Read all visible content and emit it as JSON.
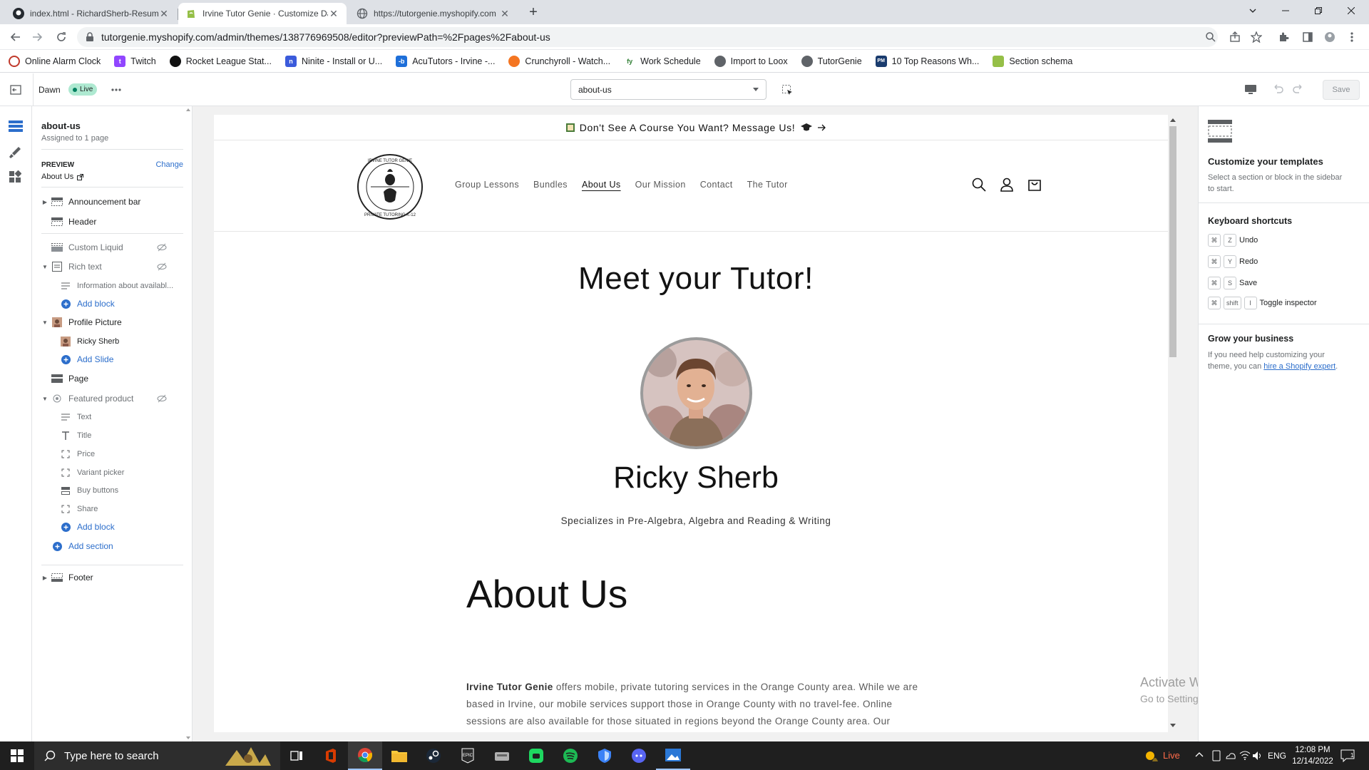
{
  "browser": {
    "tabs": [
      {
        "title": "index.html - RichardSherb-Resum",
        "active": false
      },
      {
        "title": "Irvine Tutor Genie · Customize Da",
        "active": true
      },
      {
        "title": "https://tutorgenie.myshopify.com",
        "active": false
      }
    ],
    "url": "tutorgenie.myshopify.com/admin/themes/138776969508/editor?previewPath=%2Fpages%2Fabout-us",
    "bookmarks": [
      "Online Alarm Clock",
      "Twitch",
      "Rocket League Stat...",
      "Ninite - Install or U...",
      "AcuTutors - Irvine -...",
      "Crunchyroll - Watch...",
      "Work Schedule",
      "Import to Loox",
      "TutorGenie",
      "10 Top Reasons Wh...",
      "Section schema"
    ]
  },
  "editor": {
    "theme_name": "Dawn",
    "live_badge": "Live",
    "template_select": "about-us",
    "save_label": "Save"
  },
  "sidebar": {
    "template_title": "about-us",
    "assigned": "Assigned to 1 page",
    "preview_label": "PREVIEW",
    "change_label": "Change",
    "preview_page": "About Us",
    "items": [
      {
        "label": "Announcement bar"
      },
      {
        "label": "Header"
      },
      {
        "label": "Custom Liquid"
      },
      {
        "label": "Rich text"
      },
      {
        "label": "Information about availabl..."
      },
      {
        "label": "Add block"
      },
      {
        "label": "Profile Picture"
      },
      {
        "label": "Ricky Sherb"
      },
      {
        "label": "Add Slide"
      },
      {
        "label": "Page"
      },
      {
        "label": "Featured product"
      },
      {
        "label": "Text"
      },
      {
        "label": "Title"
      },
      {
        "label": "Price"
      },
      {
        "label": "Variant picker"
      },
      {
        "label": "Buy buttons"
      },
      {
        "label": "Share"
      },
      {
        "label": "Add block"
      },
      {
        "label": "Add section"
      },
      {
        "label": "Footer"
      }
    ]
  },
  "site": {
    "announcement": "Don't See A Course You Want? Message Us!",
    "nav": [
      "Group Lessons",
      "Bundles",
      "About Us",
      "Our Mission",
      "Contact",
      "The Tutor"
    ],
    "logo_top": "IRVINE TUTOR GENIE",
    "logo_bottom": "PRIVATE TUTORING K-12",
    "heading": "Meet your Tutor!",
    "tutor_name": "Ricky Sherb",
    "specialty": "Specializes in Pre-Algebra, Algebra and Reading & Writing",
    "about_heading": "About Us",
    "about_bold": "Irvine Tutor Genie",
    "about_l1": " offers mobile, private tutoring services in the Orange County area. While we are",
    "about_l2": "based in Irvine, our mobile services support those in Orange County with no travel-fee. Online",
    "about_l3": "sessions are also available for those situated in regions beyond the Orange County area. Our"
  },
  "right_panel": {
    "customize_title": "Customize your templates",
    "customize_desc": "Select a section or block in the sidebar to start.",
    "shortcuts_title": "Keyboard shortcuts",
    "shortcuts": [
      {
        "keys": [
          "Z"
        ],
        "label": "Undo"
      },
      {
        "keys": [
          "Y"
        ],
        "label": "Redo"
      },
      {
        "keys": [
          "S"
        ],
        "label": "Save"
      },
      {
        "keys": [
          "shift",
          "I"
        ],
        "label": "Toggle inspector"
      }
    ],
    "grow_title": "Grow your business",
    "grow_desc": "If you need help customizing your theme, you can ",
    "grow_link": "hire a Shopify expert",
    "grow_end": "."
  },
  "watermark": {
    "title": "Activate Windows",
    "subtitle": "Go to Settings to activate Windows."
  },
  "taskbar": {
    "search_placeholder": "Type here to search",
    "live": "Live",
    "lang": "ENG",
    "time": "12:08 PM",
    "date": "12/14/2022"
  },
  "colors": {
    "accent": "#2c6ecb",
    "live": "#aee9d1",
    "taskbar": "#1f1f1f"
  }
}
